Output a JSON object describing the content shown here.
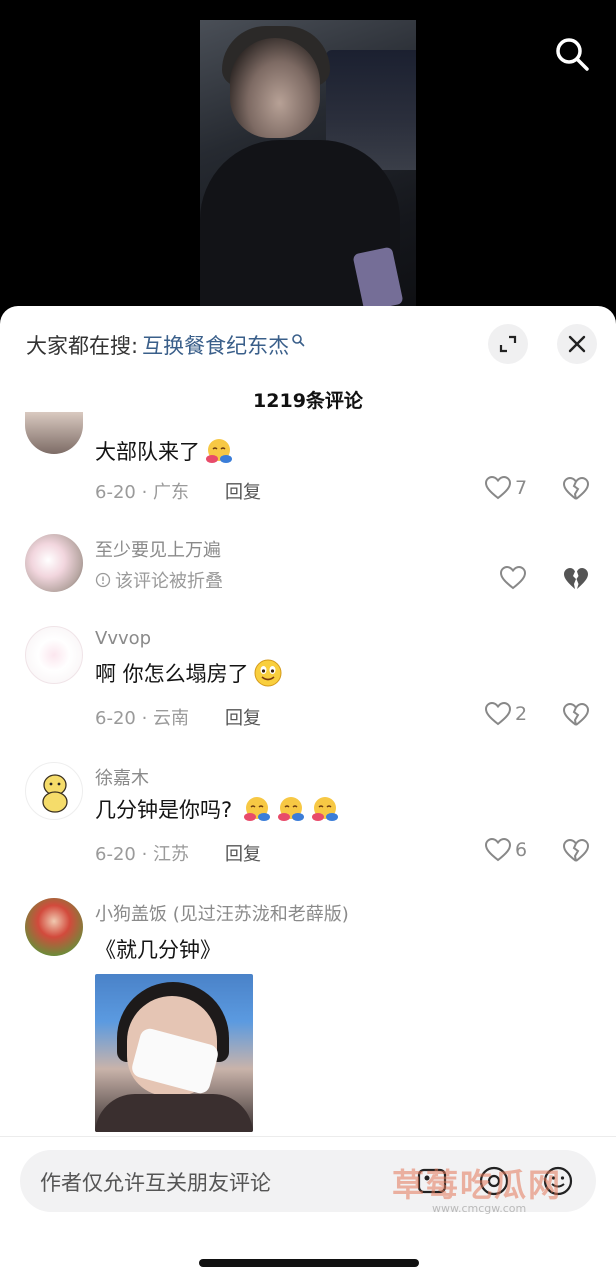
{
  "hot_search": {
    "prefix": "大家都在搜:",
    "term": "互换餐食纪东杰"
  },
  "comment_count": "1219条评论",
  "comments": [
    {
      "username": "",
      "text": "大部队来了",
      "date_location": "6-20 · 广东",
      "reply_label": "回复",
      "likes": "7",
      "emojis": [
        "hug-emoji"
      ]
    },
    {
      "username": "至少要见上万遍",
      "folded_text": "该评论被折叠",
      "likes": ""
    },
    {
      "username": "Vvvop",
      "text": "啊 你怎么塌房了",
      "date_location": "6-20 · 云南",
      "reply_label": "回复",
      "likes": "2",
      "emojis": [
        "grin-emoji"
      ]
    },
    {
      "username": "徐嘉木",
      "text": "几分钟是你吗?",
      "date_location": "6-20 · 江苏",
      "reply_label": "回复",
      "likes": "6",
      "emojis": [
        "hug-emoji",
        "hug-emoji",
        "hug-emoji"
      ]
    },
    {
      "username": "小狗盖饭 (见过汪苏泷和老薛版)",
      "text": "《就几分钟》"
    }
  ],
  "input": {
    "placeholder": "作者仅允许互关朋友评论"
  },
  "watermark": {
    "text": "草莓吃瓜网",
    "url": "www.cmcgw.com"
  },
  "colors": {
    "accent_link": "#3a5f8a",
    "sheet_bg": "#ffffff"
  }
}
